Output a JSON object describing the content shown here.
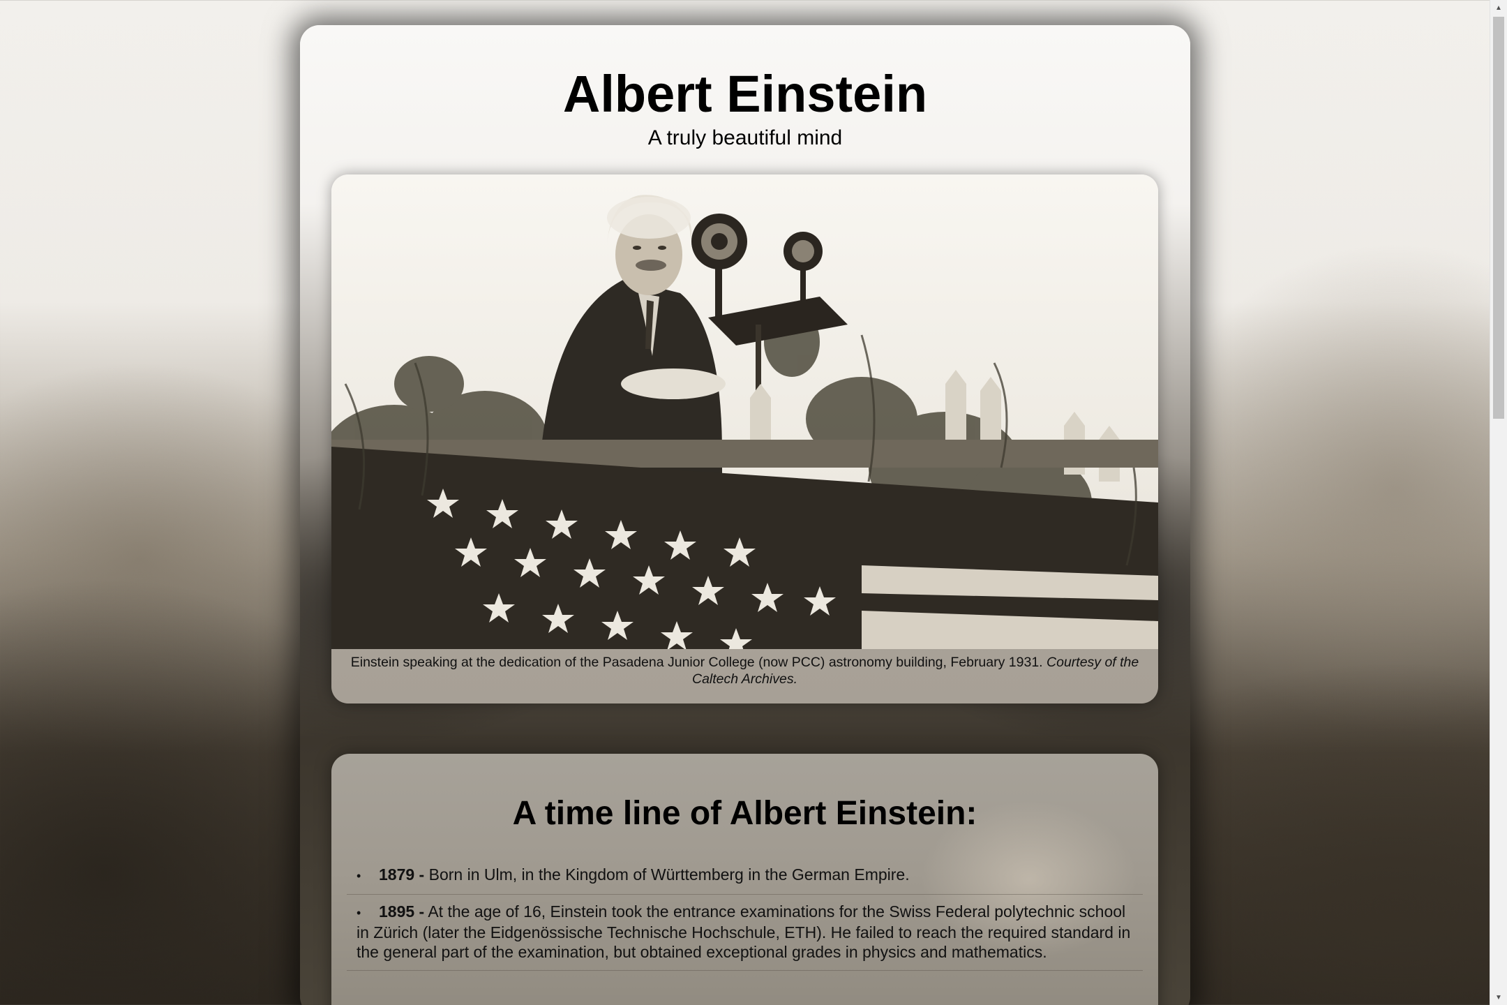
{
  "header": {
    "title": "Albert Einstein",
    "subtitle": "A truly beautiful mind"
  },
  "photo": {
    "caption_main": "Einstein speaking at the dedication of the Pasadena Junior College (now PCC) astronomy building, February 1931. ",
    "caption_credit": "Courtesy of the Caltech Archives."
  },
  "timeline": {
    "title": "A time line of Albert Einstein:",
    "items": [
      {
        "year": "1879 -",
        "text": " Born in Ulm, in the Kingdom of Württemberg in the German Empire."
      },
      {
        "year": "1895 -",
        "text": " At the age of 16, Einstein took the entrance examinations for the Swiss Federal polytechnic school in Zürich (later the Eidgenössische Technische Hochschule, ETH). He failed to reach the required standard in the general part of the examination, but obtained exceptional grades in physics and mathematics."
      }
    ]
  },
  "colors": {
    "background_light": "#f2f0ec",
    "background_dark": "#2e2820",
    "card_gray": "#a7a299"
  }
}
